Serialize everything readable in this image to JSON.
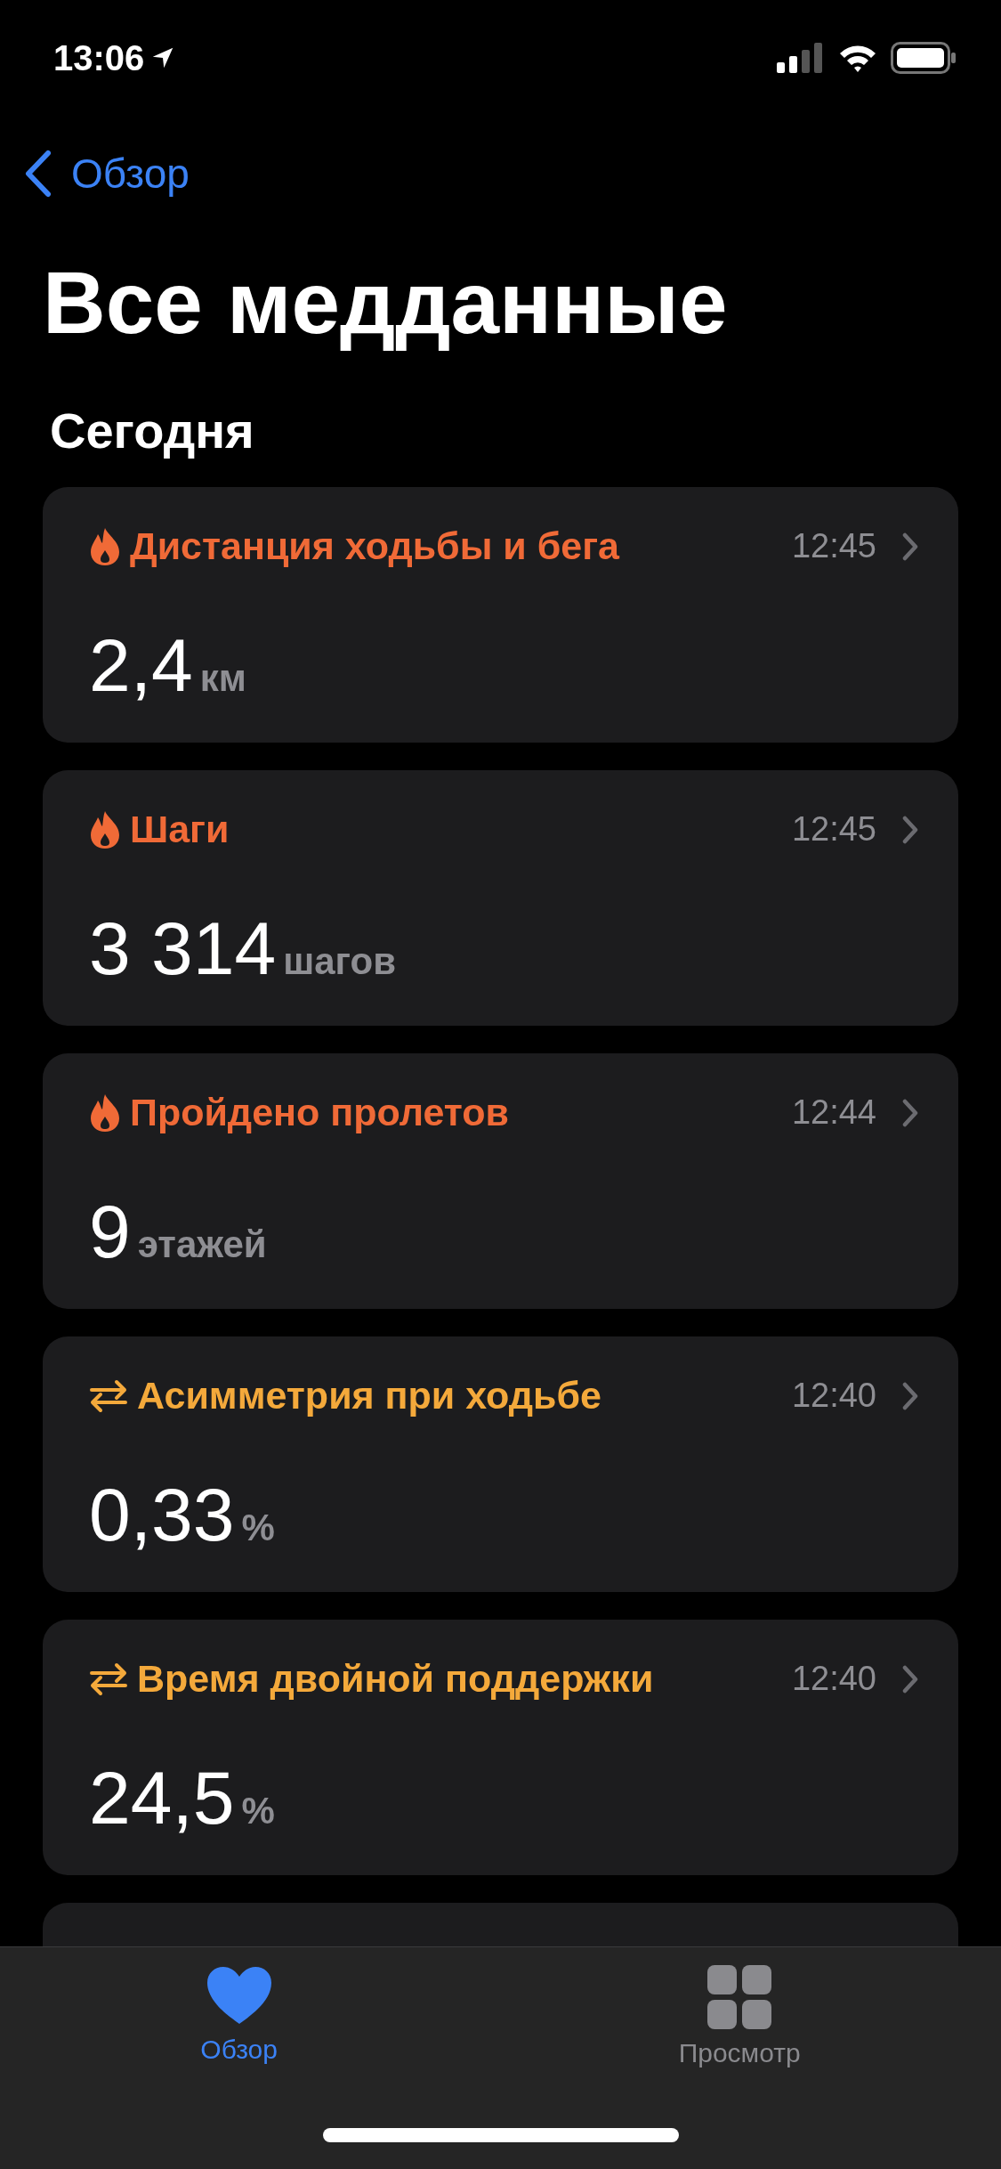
{
  "status_bar": {
    "time": "13:06"
  },
  "nav": {
    "back_label": "Обзор",
    "title": "Все медданные"
  },
  "section": {
    "title": "Сегодня"
  },
  "cards": [
    {
      "kind": "activity",
      "title": "Дистанция ходьбы и бега",
      "time": "12:45",
      "value": "2,4",
      "unit": "км"
    },
    {
      "kind": "activity",
      "title": "Шаги",
      "time": "12:45",
      "value": "3 314",
      "unit": "шагов"
    },
    {
      "kind": "activity",
      "title": "Пройдено пролетов",
      "time": "12:44",
      "value": "9",
      "unit": "этажей"
    },
    {
      "kind": "mobility",
      "title": "Асимметрия при ходьбе",
      "time": "12:40",
      "value": "0,33",
      "unit": "%"
    },
    {
      "kind": "mobility",
      "title": "Время двойной поддержки",
      "time": "12:40",
      "value": "24,5",
      "unit": "%"
    }
  ],
  "tab_bar": [
    {
      "kind": "heart",
      "label": "Обзор",
      "selected": true
    },
    {
      "kind": "grid",
      "label": "Просмотр",
      "selected": false
    }
  ]
}
